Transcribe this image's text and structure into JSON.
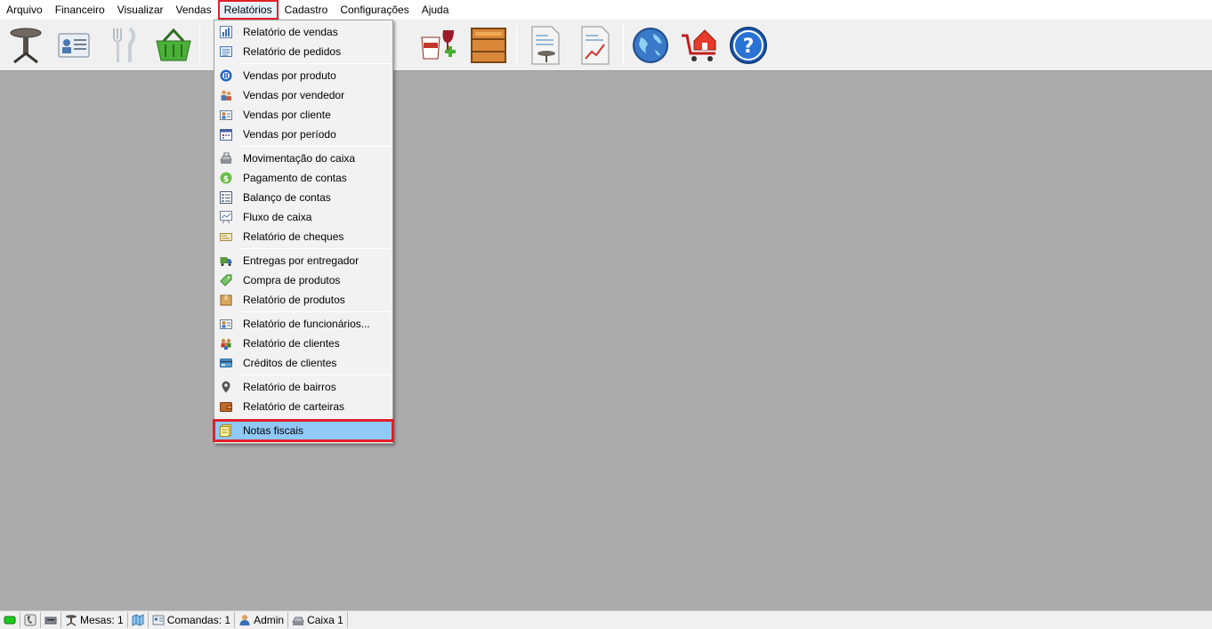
{
  "menubar": {
    "items": [
      "Arquivo",
      "Financeiro",
      "Visualizar",
      "Vendas",
      "Relatórios",
      "Cadastro",
      "Configurações",
      "Ajuda"
    ],
    "active": "Relatórios"
  },
  "toolbar": {
    "icons": [
      "table-icon",
      "customer-card-icon",
      "cutlery-icon",
      "basket-icon",
      "coffee-wine-add-icon",
      "crate-icon",
      "table-report-icon",
      "chart-report-icon",
      "globe-icon",
      "cart-house-icon",
      "help-icon"
    ]
  },
  "dropdown": {
    "groups": [
      [
        {
          "label": "Relatório de vendas",
          "icon": "bar-chart-icon"
        },
        {
          "label": "Relatório de pedidos",
          "icon": "order-list-icon"
        }
      ],
      [
        {
          "label": "Vendas por produto",
          "icon": "product-circle-icon"
        },
        {
          "label": "Vendas por vendedor",
          "icon": "sellers-icon"
        },
        {
          "label": "Vendas por cliente",
          "icon": "client-card-icon"
        },
        {
          "label": "Vendas por período",
          "icon": "calendar-icon"
        }
      ],
      [
        {
          "label": "Movimentação do caixa",
          "icon": "cash-register-icon"
        },
        {
          "label": "Pagamento de contas",
          "icon": "coin-icon"
        },
        {
          "label": "Balanço de contas",
          "icon": "checklist-icon"
        },
        {
          "label": "Fluxo de caixa",
          "icon": "flow-chart-icon"
        },
        {
          "label": "Relatório de cheques",
          "icon": "cheque-icon"
        }
      ],
      [
        {
          "label": "Entregas por entregador",
          "icon": "truck-icon"
        },
        {
          "label": "Compra de produtos",
          "icon": "money-tag-icon"
        },
        {
          "label": "Relatório de produtos",
          "icon": "box-icon"
        }
      ],
      [
        {
          "label": "Relatório de funcionários...",
          "icon": "employee-card-icon"
        },
        {
          "label": "Relatório de clientes",
          "icon": "people-icon"
        },
        {
          "label": "Créditos de clientes",
          "icon": "credit-card-icon"
        }
      ],
      [
        {
          "label": "Relatório de bairros",
          "icon": "map-pin-icon"
        },
        {
          "label": "Relatório de carteiras",
          "icon": "wallet-icon"
        }
      ],
      [
        {
          "label": "Notas fiscais",
          "icon": "invoice-note-icon",
          "highlighted": true
        }
      ]
    ]
  },
  "statusbar": {
    "mesas": "Mesas: 1",
    "comandas": "Comandas: 1",
    "user": "Admin",
    "caixa": "Caixa 1"
  },
  "colors": {
    "highlight": "#90c8f6",
    "annotation": "#e0202a",
    "workspace": "#ababab"
  }
}
